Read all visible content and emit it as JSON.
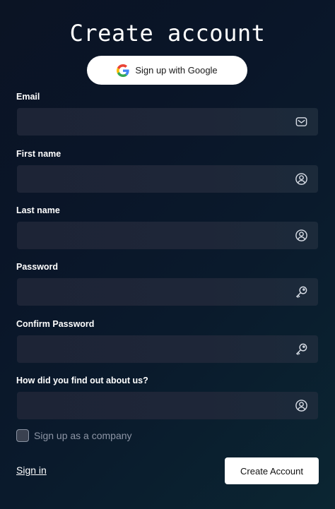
{
  "header": {
    "title": "Create account"
  },
  "google_signup": {
    "label": "Sign up with Google",
    "icon": "google-g-icon"
  },
  "fields": [
    {
      "label": "Email",
      "value": "",
      "placeholder": "",
      "icon": "mail-icon"
    },
    {
      "label": "First name",
      "value": "",
      "placeholder": "",
      "icon": "user-icon"
    },
    {
      "label": "Last name",
      "value": "",
      "placeholder": "",
      "icon": "user-icon"
    },
    {
      "label": "Password",
      "value": "",
      "placeholder": "",
      "icon": "key-icon"
    },
    {
      "label": "Confirm Password",
      "value": "",
      "placeholder": "",
      "icon": "key-icon"
    },
    {
      "label": "How did you find out about us?",
      "value": "",
      "placeholder": "",
      "icon": "user-icon"
    }
  ],
  "company_checkbox": {
    "label": "Sign up as a company",
    "checked": false
  },
  "footer": {
    "signin_label": "Sign in",
    "submit_label": "Create Account"
  },
  "colors": {
    "background_start": "#0b1424",
    "background_end": "#0b2632",
    "field_background": "#1e2638",
    "icon_color": "#d8dde6",
    "muted_text": "#8d95a5"
  }
}
